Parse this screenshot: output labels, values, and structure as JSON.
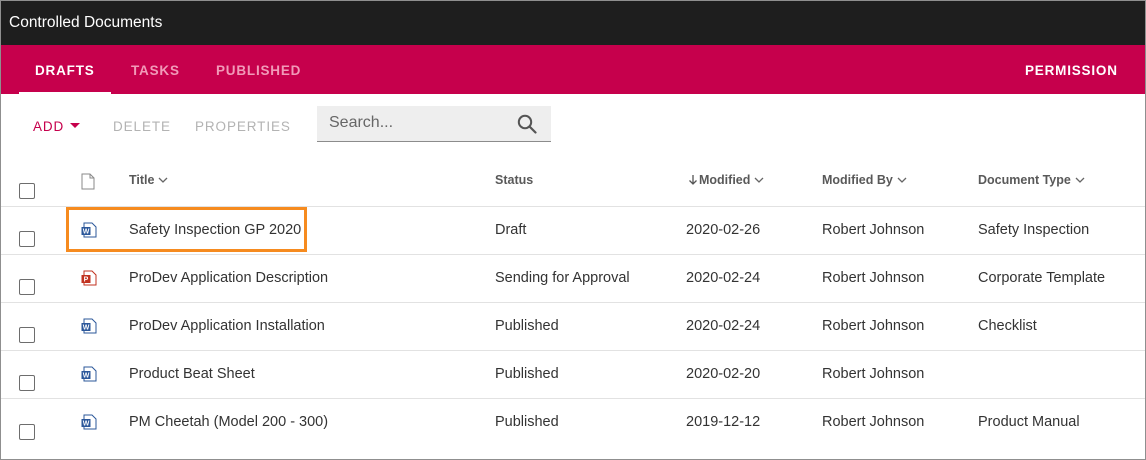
{
  "window": {
    "title": "Controlled Documents"
  },
  "tabs": [
    {
      "label": "DRAFTS",
      "active": true
    },
    {
      "label": "TASKS",
      "active": false
    },
    {
      "label": "PUBLISHED",
      "active": false
    }
  ],
  "permission_label": "PERMISSION",
  "toolbar": {
    "add_label": "ADD",
    "delete_label": "DELETE",
    "properties_label": "PROPERTIES"
  },
  "search": {
    "placeholder": "Search...",
    "value": ""
  },
  "columns": {
    "icon": "file-icon",
    "title": "Title",
    "status": "Status",
    "modified": "Modified",
    "modified_by": "Modified By",
    "document_type": "Document Type"
  },
  "sort": {
    "column": "modified",
    "direction": "descending"
  },
  "rows": [
    {
      "icon": "word-file-icon",
      "title": "Safety Inspection GP 2020",
      "status": "Draft",
      "modified": "2020-02-26",
      "modified_by": "Robert Johnson",
      "document_type": "Safety Inspection",
      "highlighted": true
    },
    {
      "icon": "pdf-file-icon",
      "title": "ProDev Application Description",
      "status": "Sending for Approval",
      "modified": "2020-02-24",
      "modified_by": "Robert Johnson",
      "document_type": "Corporate Template",
      "highlighted": false
    },
    {
      "icon": "word-file-icon",
      "title": "ProDev Application Installation",
      "status": "Published",
      "modified": "2020-02-24",
      "modified_by": "Robert Johnson",
      "document_type": "Checklist",
      "highlighted": false
    },
    {
      "icon": "word-file-icon",
      "title": "Product Beat Sheet",
      "status": "Published",
      "modified": "2020-02-20",
      "modified_by": "Robert Johnson",
      "document_type": "",
      "highlighted": false
    },
    {
      "icon": "word-file-icon",
      "title": "PM Cheetah (Model 200 - 300)",
      "status": "Published",
      "modified": "2019-12-12",
      "modified_by": "Robert Johnson",
      "document_type": "Product Manual",
      "highlighted": false
    }
  ],
  "colors": {
    "titlebar": "#1e1e1e",
    "accent": "#c6004c",
    "inactive_tab": "#f19ab8",
    "highlight": "#f68b1f",
    "word_icon": "#2b579a",
    "pdf_icon": "#c1311f"
  }
}
